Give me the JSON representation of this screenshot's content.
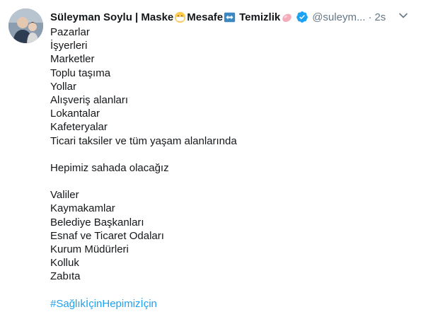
{
  "user": {
    "name_part1": "Süleyman Soylu | Maske",
    "name_part2": "Mesafe",
    "name_part3": "Temizlik",
    "handle": "@suleym...",
    "dot": "·",
    "time": "2s"
  },
  "icons": {
    "mask": "face-with-medical-mask-icon",
    "distance": "left-right-arrow-icon",
    "cleanliness": "soap-icon",
    "verified": "verified-badge-icon",
    "more": "chevron-down-icon"
  },
  "colors": {
    "text": "#14171a",
    "secondary": "#657786",
    "link": "#1da1f2"
  },
  "tweet": {
    "lines_group1": [
      "Pazarlar",
      "İşyerleri",
      "Marketler",
      "Toplu taşıma",
      "Yollar",
      "Alışveriş alanları",
      "Lokantalar",
      "Kafeteryalar",
      "Ticari taksiler ve tüm yaşam alanlarında"
    ],
    "line_middle": "Hepimiz sahada olacağız",
    "lines_group2": [
      "Valiler",
      "Kaymakamlar",
      "Belediye Başkanları",
      "Esnaf ve Ticaret Odaları",
      "Kurum Müdürleri",
      "Kolluk",
      "Zabıta"
    ],
    "hashtag": "#SağlıkİçinHepimizİçin"
  }
}
